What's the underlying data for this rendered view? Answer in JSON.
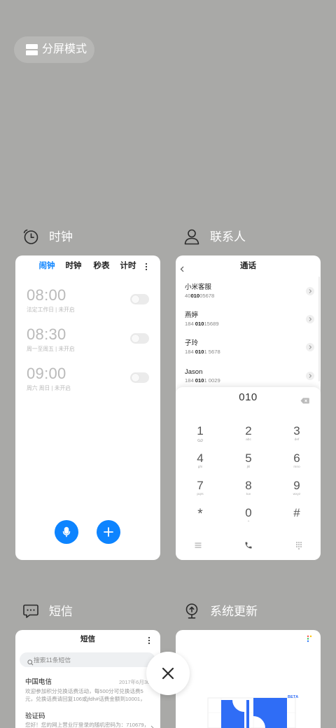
{
  "page": {
    "background": "#a9a9a7"
  },
  "split_screen": {
    "label": "分屏模式",
    "icon": "split-screen-icon"
  },
  "close_button": {
    "icon": "close-icon"
  },
  "clock": {
    "title": "时钟",
    "icon": "clock-icon",
    "accent": "#0d84ff",
    "tabs": [
      {
        "label": "闹钟",
        "active": true
      },
      {
        "label": "时钟",
        "active": false
      },
      {
        "label": "秒表",
        "active": false
      },
      {
        "label": "计时",
        "active": false
      }
    ],
    "alarms": [
      {
        "time": "08:00",
        "detail": "法定工作日 | 未开启",
        "enabled": false
      },
      {
        "time": "08:30",
        "detail": "周一至周五 | 未开启",
        "enabled": false
      },
      {
        "time": "09:00",
        "detail": "周六 周日 | 未开启",
        "enabled": false
      }
    ],
    "actions": [
      "mic-icon",
      "plus-icon"
    ]
  },
  "contacts": {
    "title": "联系人",
    "icon": "contacts-icon",
    "header": "通话",
    "entries": [
      {
        "name": "小米客服",
        "number_before": "40",
        "number_match": "010",
        "number_after": "05678"
      },
      {
        "name": "燕婷",
        "number_before": "184 ",
        "number_match": "010",
        "number_after": "15689"
      },
      {
        "name": "子玲",
        "number_before": "184 ",
        "number_match": "010",
        "number_after": "1 5678"
      },
      {
        "name": "Jason",
        "number_before": "184 ",
        "number_match": "010",
        "number_after": "1 0029"
      }
    ],
    "dial_input": "010",
    "keys": [
      {
        "digit": "1",
        "icon": "voicemail-icon"
      },
      {
        "digit": "2",
        "letters": "abc"
      },
      {
        "digit": "3",
        "letters": "def"
      },
      {
        "digit": "4",
        "letters": "ghi"
      },
      {
        "digit": "5",
        "letters": "jkl"
      },
      {
        "digit": "6",
        "letters": "mno"
      },
      {
        "digit": "7",
        "letters": "pqrs"
      },
      {
        "digit": "8",
        "letters": "tuv"
      },
      {
        "digit": "9",
        "letters": "wxyz"
      },
      {
        "digit": "*"
      },
      {
        "digit": "0",
        "letters": "+"
      },
      {
        "digit": "#"
      }
    ],
    "bottom_actions": [
      "menu-icon",
      "call-icon",
      "dialpad-icon"
    ]
  },
  "messages": {
    "title": "短信",
    "icon": "message-icon",
    "header": "短信",
    "search_placeholder": "搜索11条短信",
    "threads": [
      {
        "sender": "中国电信",
        "date": "2017年6月30",
        "preview": "欢迎参加积分兑换话费活动，每500分可兑换话费5元，兑换话费请回复106或jfdh#话费金额到10001，回复..."
      },
      {
        "sender": "验证码",
        "preview": "您好！您的网上营业厅登录的随机密码为：710679，有"
      }
    ]
  },
  "update": {
    "title": "系统更新",
    "icon": "system-update-icon",
    "badge": "BETA",
    "accent": "#2f6df6"
  }
}
